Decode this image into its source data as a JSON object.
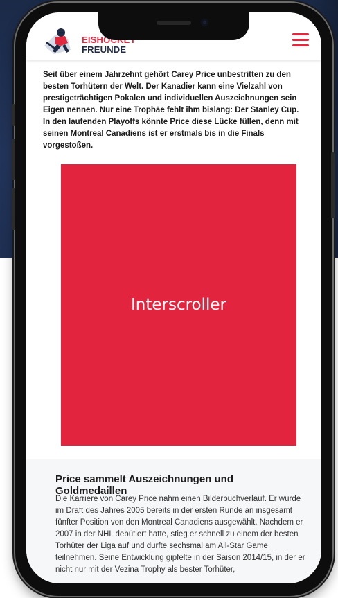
{
  "site": {
    "brand_line1": "EISHOCKEY",
    "brand_line2": "FREUNDE",
    "accent_color": "#e0283e",
    "navy_color": "#1f2a44",
    "logo_icon": "hockey-player-logo-icon",
    "menu_icon": "hamburger-menu-icon"
  },
  "article": {
    "intro": "Seit über einem Jahrzehnt gehört Carey Price unbestritten zu den besten Torhütern der Welt. Der Kanadier kann eine Vielzahl von prestigeträchtigen Pokalen und individuellen Auszeichnungen sein Eigen nennen. Nur eine Trophäe fehlt ihm bislang: Der Stanley Cup. In den laufenden Playoffs könnte Price diese Lücke füllen, denn mit seinen Montreal Canadiens ist er erstmals bis in die Finals vorgestoßen.",
    "ad_label": "Interscroller",
    "ad_color": "#e2243f",
    "section_heading": "Price sammelt Auszeichnungen und Goldmedaillen",
    "section_body": "Die Karriere von Carey Price nahm einen Bilderbuchverlauf. Er wurde im Draft des Jahres 2005 bereits in der ersten Runde an insgesamt fünfter Position von den Montreal Canadiens ausgewählt. Nachdem er 2007 in der NHL debütiert hatte, stieg er schnell zu einem der besten Torhüter der Liga auf und durfte sechsmal am All-Star Game teilnehmen. Seine Entwicklung gipfelte in der Saison 2014/15, in der er nicht nur mit der Vezina Trophy als bester Torhüter,"
  }
}
